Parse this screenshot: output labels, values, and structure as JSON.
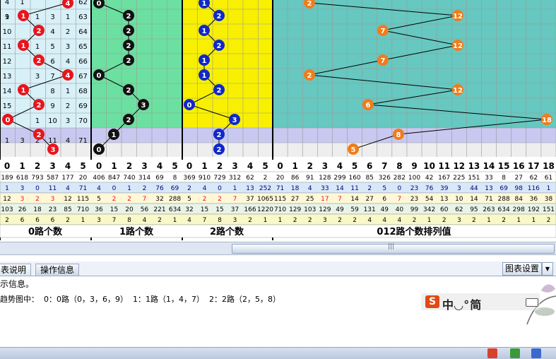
{
  "trend": {
    "rows": [
      9,
      10,
      11,
      12,
      13,
      14,
      15,
      16,
      null,
      null
    ],
    "col0_vals": [
      [
        "4",
        "1",
        "",
        "",
        "4",
        "62"
      ],
      [
        "1",
        "",
        "1",
        "3",
        "1",
        "63"
      ],
      [
        "",
        "",
        "2",
        "4",
        "2",
        "64"
      ],
      [
        "",
        "",
        "1",
        "5",
        "3",
        "65"
      ],
      [
        "",
        "",
        "2",
        "6",
        "4",
        "66"
      ],
      [
        "",
        "",
        "3",
        "7",
        "4",
        "67"
      ],
      [
        "",
        "",
        "",
        "8",
        "1",
        "68"
      ],
      [
        "",
        "",
        "",
        "9",
        "2",
        "69"
      ],
      [
        "",
        "",
        "1",
        "10",
        "3",
        "70"
      ],
      [
        "1",
        "3",
        "2",
        "11",
        "4",
        "71"
      ]
    ]
  },
  "footer": {
    "headers": [
      "0",
      "1",
      "2",
      "3",
      "4",
      "5",
      "0",
      "1",
      "2",
      "3",
      "4",
      "5",
      "0",
      "1",
      "2",
      "3",
      "4",
      "5",
      "0",
      "1",
      "2",
      "3",
      "4",
      "5",
      "6",
      "7",
      "8",
      "9",
      "10",
      "11",
      "12",
      "13",
      "14",
      "15",
      "16",
      "17",
      "18"
    ],
    "stats": [
      [
        "189",
        "618",
        "793",
        "587",
        "177",
        "20",
        "406",
        "847",
        "740",
        "314",
        "69",
        "8",
        "369",
        "910",
        "729",
        "312",
        "62",
        "2",
        "20",
        "86",
        "91",
        "128",
        "299",
        "160",
        "85",
        "326",
        "282",
        "100",
        "42",
        "167",
        "225",
        "151",
        "33",
        "8",
        "27",
        "62",
        "61"
      ],
      [
        "1",
        "3",
        "0",
        "11",
        "4",
        "71",
        "4",
        "0",
        "1",
        "2",
        "76",
        "69",
        "2",
        "4",
        "0",
        "1",
        "13",
        "252",
        "71",
        "18",
        "4",
        "33",
        "14",
        "11",
        "2",
        "5",
        "0",
        "23",
        "76",
        "39",
        "3",
        "44",
        "13",
        "69",
        "98",
        "116",
        "1"
      ],
      [
        "12",
        "3",
        "2",
        "3",
        "12",
        "115",
        "5",
        "2",
        "2",
        "7",
        "32",
        "288",
        "5",
        "2",
        "2",
        "7",
        "37",
        "1065",
        "115",
        "27",
        "25",
        "17",
        "7",
        "14",
        "27",
        "6",
        "7",
        "23",
        "54",
        "13",
        "10",
        "14",
        "71",
        "288",
        "84",
        "36",
        "38"
      ],
      [
        "103",
        "26",
        "18",
        "23",
        "85",
        "710",
        "36",
        "15",
        "20",
        "56",
        "221",
        "634",
        "32",
        "15",
        "15",
        "37",
        "166",
        "1220",
        "710",
        "129",
        "103",
        "129",
        "49",
        "59",
        "131",
        "49",
        "40",
        "99",
        "342",
        "60",
        "62",
        "95",
        "263",
        "634",
        "298",
        "192",
        "151"
      ],
      [
        "2",
        "6",
        "6",
        "6",
        "2",
        "1",
        "3",
        "7",
        "8",
        "4",
        "2",
        "1",
        "4",
        "7",
        "8",
        "3",
        "2",
        "1",
        "1",
        "2",
        "2",
        "3",
        "2",
        "2",
        "4",
        "4",
        "4",
        "2",
        "1",
        "2",
        "3",
        "2",
        "1",
        "2",
        "1",
        "1",
        "2"
      ]
    ],
    "group_labels": [
      "0路个数",
      "1路个数",
      "2路个数",
      "012路个数排列值"
    ]
  },
  "tabs": {
    "tab1": "表说明",
    "tab2": "操作信息",
    "settings": "图表设置"
  },
  "info": {
    "line1": "示信息。",
    "line2": "趋势图中：  0：0路（0，3，6，9）  1：1路（1，4，7）  2：2路（2，5，8）"
  },
  "ime": {
    "logo": "S",
    "text": "中◡°简"
  },
  "colors": {
    "red_ball": "#e8141c",
    "black_ball": "#111111",
    "blue_ball": "#1028c8",
    "orange_ball": "#f07c1a",
    "light_blue_bg": "#d8f0f8",
    "green_bg": "#6ce0a0",
    "yellow_bg": "#f8f000",
    "teal_bg": "#66c8c0",
    "lavender_bg": "#c8c8f0"
  }
}
